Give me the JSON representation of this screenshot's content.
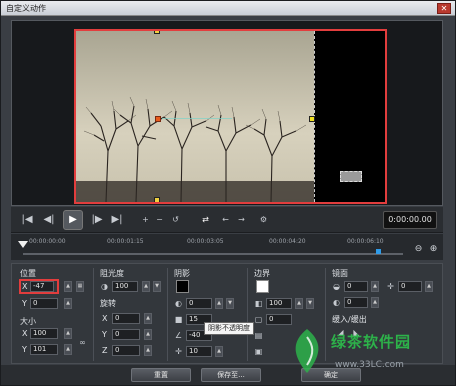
{
  "window": {
    "title": "自定义动作",
    "close_glyph": "✕"
  },
  "transport": {
    "buttons": [
      "|◀",
      "◀|",
      "▶",
      "|▶",
      "▶|"
    ],
    "timecode": "0:00:00.00"
  },
  "ruler": {
    "ticks": [
      "00:00:00:00",
      "00:00:01:15",
      "00:00:03:05",
      "00:00:04:20",
      "00:00:06:10"
    ]
  },
  "panel": {
    "position": {
      "label": "位置",
      "x_label": "X",
      "x_value": "-47",
      "y_label": "Y",
      "y_value": "0"
    },
    "size": {
      "label": "大小",
      "x_label": "X",
      "x_value": "100",
      "y_label": "Y",
      "y_value": "101"
    },
    "opacity": {
      "label": "阻光度",
      "value": "100"
    },
    "rotation": {
      "label": "旋转",
      "x_label": "X",
      "x_value": "0",
      "y_label": "Y",
      "y_value": "0",
      "z_label": "Z",
      "z_value": "0"
    },
    "shadow": {
      "label": "阴影",
      "color": "#000000",
      "opacity_value": "0",
      "blur_value": "15",
      "angle_value": "-40",
      "distance_value": "10"
    },
    "border": {
      "label": "边界",
      "color": "#ffffff",
      "width_value": "100",
      "value2": "0"
    },
    "mirror": {
      "label": "镜面",
      "value1": "0",
      "value2": "0",
      "value3": "0"
    },
    "fade": {
      "label": "缓入/缓出"
    }
  },
  "tooltip": "阴影不透明度",
  "footer": {
    "reset_label": "重置",
    "save_label": "保存至...",
    "ok_label": "确定"
  },
  "watermark": {
    "text": "绿茶软件园",
    "url": "www.33LC.com"
  },
  "colors": {
    "selection": "#e23d3d",
    "accent": "#2f9be8"
  }
}
